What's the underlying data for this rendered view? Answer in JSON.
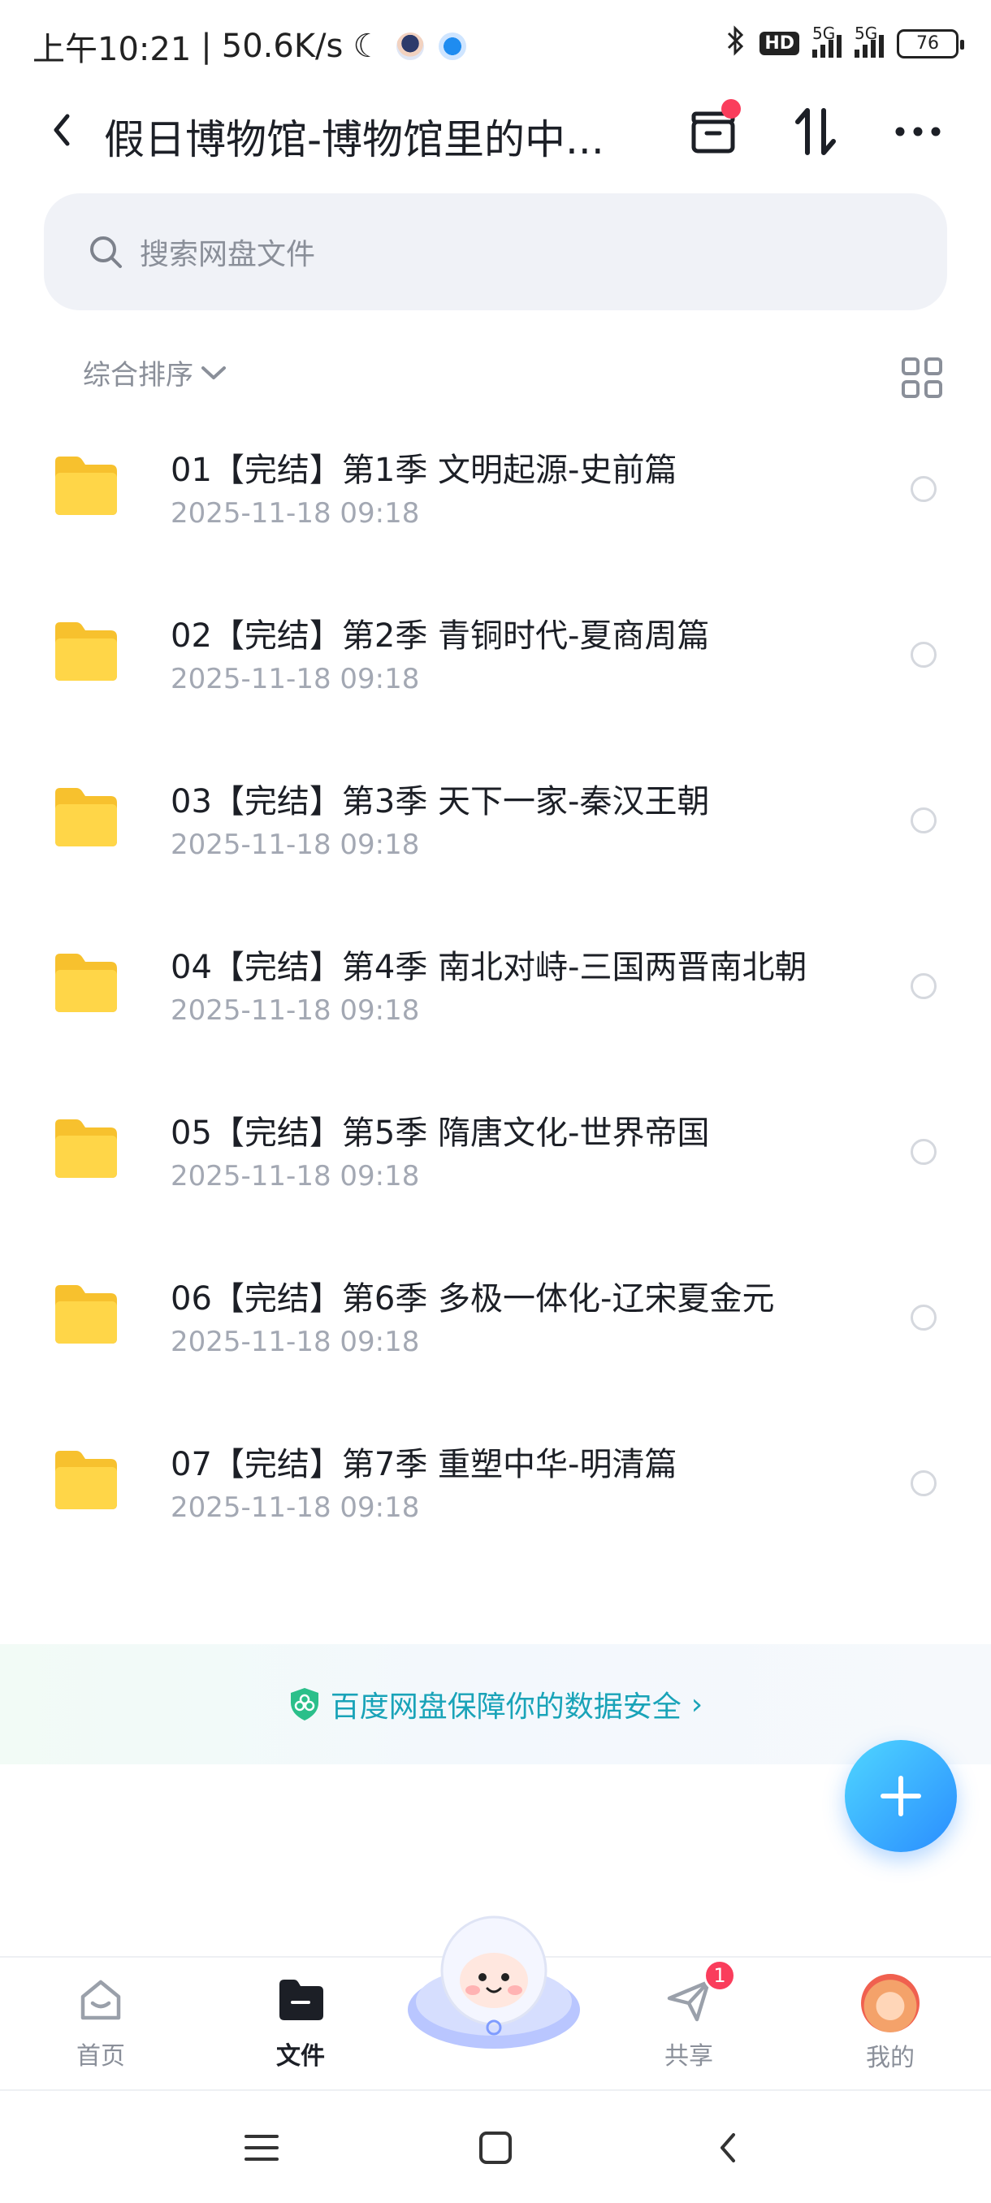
{
  "status_bar": {
    "time": "上午10:21",
    "separator": "|",
    "speed": "50.6K/s",
    "hd_label": "HD",
    "network_1": "5G",
    "network_2": "5G",
    "battery": "76"
  },
  "header": {
    "title": "假日博物馆-博物馆里的中...",
    "has_notification_dot": true
  },
  "search": {
    "placeholder": "搜索网盘文件"
  },
  "sort": {
    "label": "综合排序"
  },
  "files": [
    {
      "name": "01【完结】第1季 文明起源-史前篇",
      "date": "2025-11-18  09:18"
    },
    {
      "name": "02【完结】第2季 青铜时代-夏商周篇",
      "date": "2025-11-18  09:18"
    },
    {
      "name": "03【完结】第3季 天下一家-秦汉王朝",
      "date": "2025-11-18  09:18"
    },
    {
      "name": "04【完结】第4季 南北对峙-三国两晋南北朝",
      "date": "2025-11-18  09:18"
    },
    {
      "name": "05【完结】第5季 隋唐文化-世界帝国",
      "date": "2025-11-18  09:18"
    },
    {
      "name": "06【完结】第6季 多极一体化-辽宋夏金元",
      "date": "2025-11-18  09:18"
    },
    {
      "name": "07【完结】第7季 重塑中华-明清篇",
      "date": "2025-11-18  09:18"
    }
  ],
  "security_banner": {
    "text": "百度网盘保障你的数据安全",
    "chevron": "›"
  },
  "bottom_nav": {
    "home": "首页",
    "files": "文件",
    "share": "共享",
    "share_badge": "1",
    "me": "我的"
  },
  "colors": {
    "accent": "#2a8dff",
    "folder": "#ffcf3a",
    "badge": "#fa3d5c",
    "secure_text": "#19a3b8"
  }
}
